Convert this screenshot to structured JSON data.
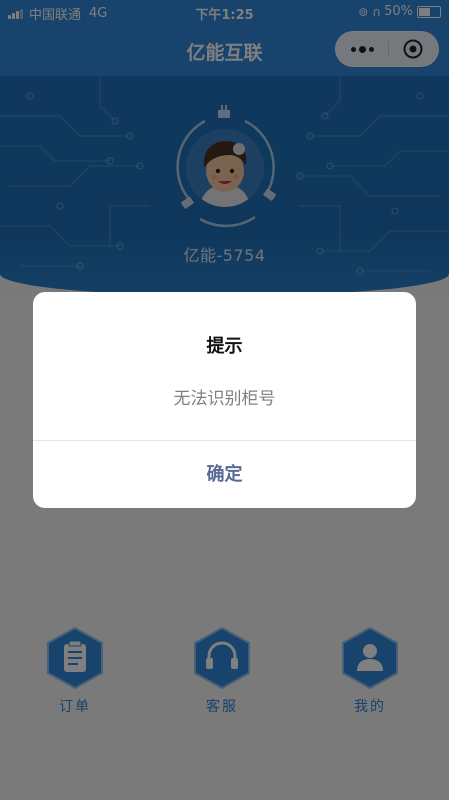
{
  "status_bar": {
    "carrier": "中国联通",
    "network": "4G",
    "time": "下午1:25",
    "battery": "50%"
  },
  "nav": {
    "title": "亿能互联"
  },
  "profile": {
    "username": "亿能-5754"
  },
  "tabs": [
    {
      "label": "订单",
      "icon": "order-icon"
    },
    {
      "label": "客服",
      "icon": "headset-icon"
    },
    {
      "label": "我的",
      "icon": "user-icon"
    }
  ],
  "dialog": {
    "title": "提示",
    "content": "无法识别柜号",
    "confirm_label": "确定"
  },
  "colors": {
    "brand": "#2f86d8",
    "header_dark": "#1e6fb8",
    "confirm": "#576b95"
  }
}
